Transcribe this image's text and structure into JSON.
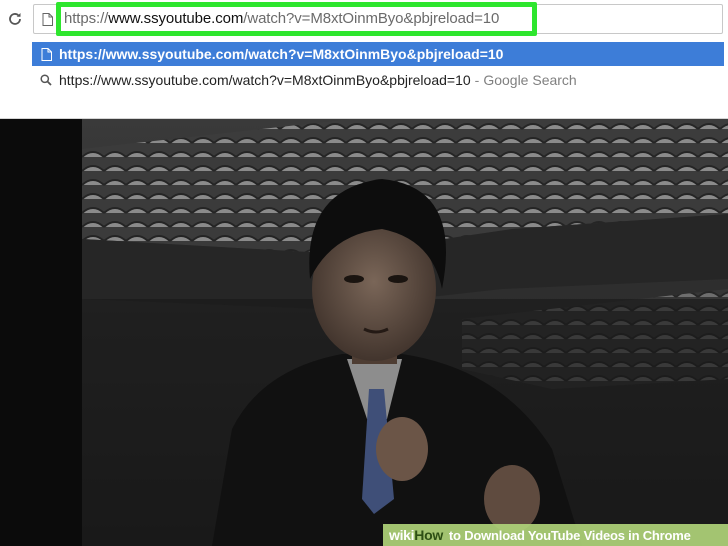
{
  "browser": {
    "address_bar": {
      "url_scheme": "https://",
      "url_host": "www.ssyoutube.com",
      "url_path": "/watch?v=M8xtOinmByo&pbjreload=10"
    },
    "suggestions": [
      {
        "icon": "page-icon",
        "text": "https://www.ssyoutube.com/watch?v=M8xtOinmByo&pbjreload=10",
        "selected": true
      },
      {
        "icon": "search-icon",
        "text": "https://www.ssyoutube.com/watch?v=M8xtOinmByo&pbjreload=10",
        "separator": "-",
        "hint": "Google Search",
        "selected": false
      }
    ]
  },
  "highlight_color": "#2ee62e",
  "selected_color": "#3d7dd8",
  "watermark": {
    "logo_wiki": "wiki",
    "logo_how": "How",
    "title": "to Download YouTube Videos in Chrome"
  }
}
